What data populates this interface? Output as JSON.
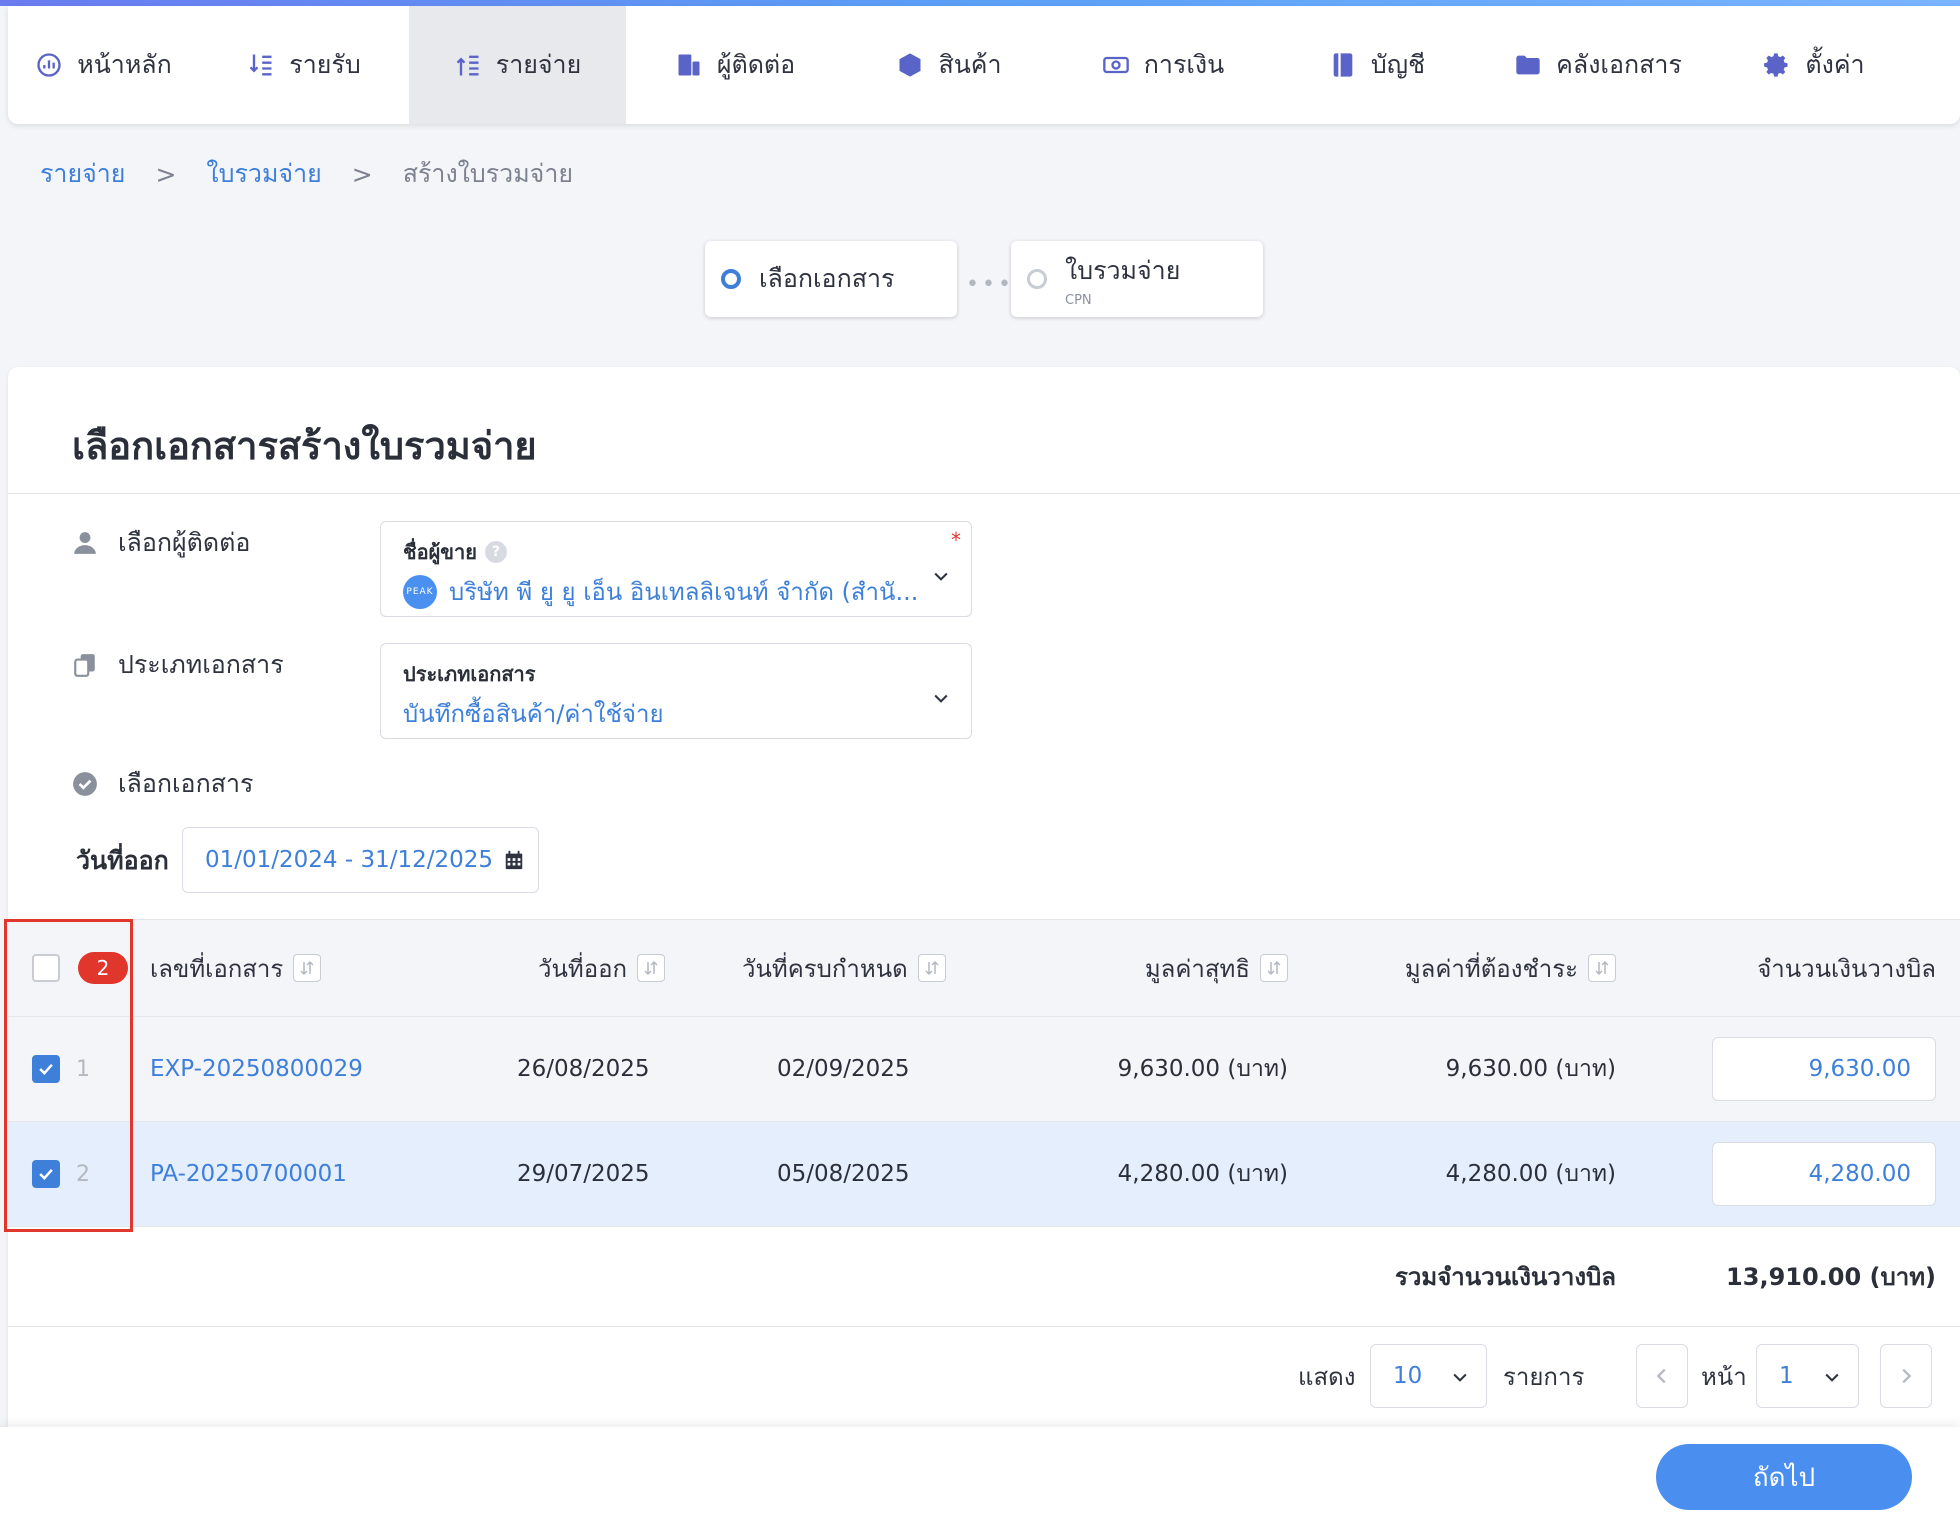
{
  "nav": {
    "items": [
      {
        "label": "หน้าหลัก",
        "icon": "dashboard-icon"
      },
      {
        "label": "รายรับ",
        "icon": "income-icon"
      },
      {
        "label": "รายจ่าย",
        "icon": "expense-icon",
        "active": true
      },
      {
        "label": "ผู้ติดต่อ",
        "icon": "contacts-icon"
      },
      {
        "label": "สินค้า",
        "icon": "box-icon"
      },
      {
        "label": "การเงิน",
        "icon": "money-icon"
      },
      {
        "label": "บัญชี",
        "icon": "ledger-icon"
      },
      {
        "label": "คลังเอกสาร",
        "icon": "folder-icon"
      },
      {
        "label": "ตั้งค่า",
        "icon": "gear-icon"
      }
    ]
  },
  "breadcrumb": {
    "items": [
      "รายจ่าย",
      "ใบรวมจ่าย"
    ],
    "separator": ">",
    "current": "สร้างใบรวมจ่าย"
  },
  "stepper": {
    "step1": {
      "label": "เลือกเอกสาร"
    },
    "step2": {
      "label": "ใบรวมจ่าย",
      "sub": "CPN"
    },
    "dots": "•••"
  },
  "form": {
    "title": "เลือกเอกสารสร้างใบรวมจ่าย",
    "contact_label": "เลือกผู้ติดต่อ",
    "vendor": {
      "caption": "ชื่อผู้ขาย",
      "help": "?",
      "required": "*",
      "logo_text": "PEAK",
      "value": "บริษัท พี ยู ยู เอ็น อินเทลลิเจนท์ จำกัด (สำนั..."
    },
    "doctype_label": "ประเภทเอกสาร",
    "doctype": {
      "caption": "ประเภทเอกสาร",
      "value": "บันทึกซื้อสินค้า/ค่าใช้จ่าย"
    },
    "select_docs_label": "เลือกเอกสาร",
    "date_label": "วันที่ออก",
    "date_range": "01/01/2024 - 31/12/2025"
  },
  "table": {
    "selected_count": "2",
    "headers": {
      "doc_no": "เลขที่เอกสาร",
      "issue_date": "วันที่ออก",
      "due_date": "วันที่ครบกำหนด",
      "net": "มูลค่าสุทธิ",
      "payable": "มูลค่าที่ต้องชำระ",
      "billing": "จำนวนเงินวางบิล"
    },
    "rows": [
      {
        "num": "1",
        "doc_no": "EXP-20250800029",
        "issue_date": "26/08/2025",
        "due_date": "02/09/2025",
        "net": "9,630.00 (บาท)",
        "payable": "9,630.00 (บาท)",
        "billing": "9,630.00",
        "checked": true
      },
      {
        "num": "2",
        "doc_no": "PA-20250700001",
        "issue_date": "29/07/2025",
        "due_date": "05/08/2025",
        "net": "4,280.00 (บาท)",
        "payable": "4,280.00 (บาท)",
        "billing": "4,280.00",
        "checked": true
      }
    ],
    "total_label": "รวมจำนวนเงินวางบิล",
    "total_value": "13,910.00 (บาท)"
  },
  "pagination": {
    "show_label": "แสดง",
    "page_size": "10",
    "items_label": "รายการ",
    "page_label": "หน้า",
    "page": "1"
  },
  "footer": {
    "next_label": "ถัดไป"
  },
  "colors": {
    "accent": "#3d7fd9",
    "badge": "#e0362c",
    "highlight_row": "#e4eefc"
  }
}
